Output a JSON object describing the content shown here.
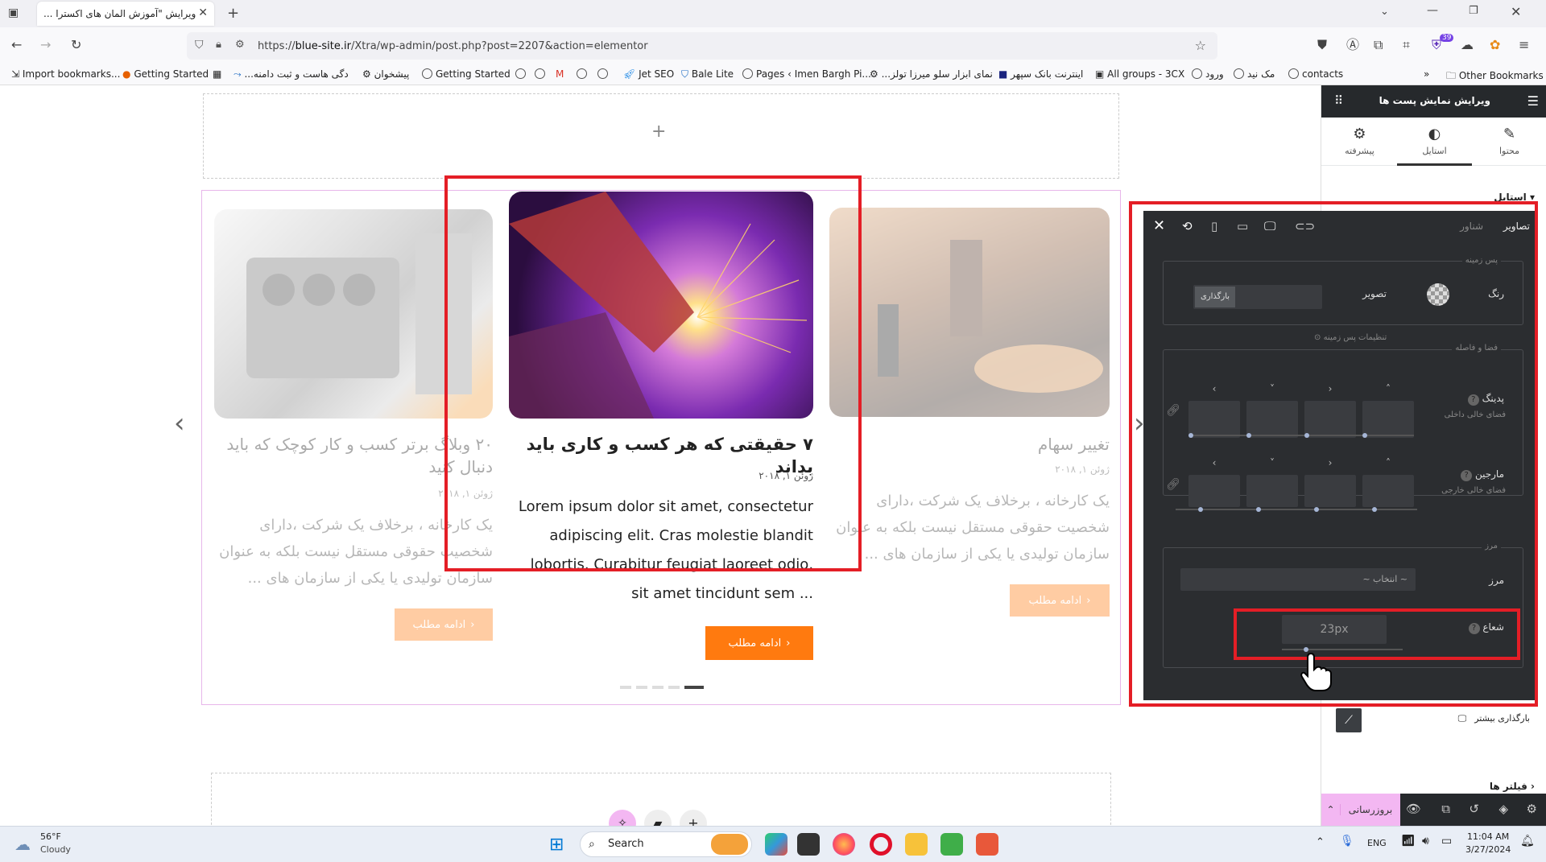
{
  "browser": {
    "tab_title": "ویرایش \"آموزش المان های اکسترا ...",
    "url_prefix": "https://",
    "url_domain": "blue-site.ir",
    "url_rest": "/Xtra/wp-admin/post.php?post=2207&action=elementor",
    "bookmarks": [
      "Import bookmarks...",
      "Getting Started",
      "...دگی هاست و ثبت دامنه",
      "پیشخوان",
      "Getting Started",
      "Jet SEO",
      "Bale Lite",
      "Pages ‹ Imen Bargh Pi...",
      "...نمای ابزار سلو میرزا تولز",
      "اینترنت بانک سپهر",
      "All groups - 3CX",
      "ورود",
      "مک نید",
      "contacts"
    ],
    "other_bookmarks": "Other Bookmarks",
    "extension_badge": "39"
  },
  "canvas": {
    "add_section": "+",
    "cards": [
      {
        "title": "۲۰ وبلاگ برتر کسب و کار کوچک که باید دنبال کنید",
        "date": "ژوئن ۱, ۲۰۱۸",
        "excerpt": "یک کارخانه ، برخلاف یک شرکت ،دارای شخصیت حقوقی مستقل نیست بلکه به عنوان سازمان تولیدی یا یکی از سازمان های ...",
        "button": "ادامه مطلب"
      },
      {
        "title": "۷ حقیقتی که هر کسب و کاری باید بداند",
        "date": "ژوئن ۱, ۲۰۱۸",
        "excerpt": "Lorem ipsum dolor sit amet, consectetur adipiscing elit. Cras molestie blandit lobortis. Curabitur feugiat laoreet odio, sit amet tincidunt sem ...",
        "button": "ادامه مطلب"
      },
      {
        "title": "تغییر سهام",
        "date": "ژوئن ۱, ۲۰۱۸",
        "excerpt": "یک کارخانه ، برخلاف یک شرکت ،دارای شخصیت حقوقی مستقل نیست بلکه به عنوان سازمان تولیدی یا یکی از سازمان های ...",
        "button": "ادامه مطلب"
      }
    ],
    "prev_arrow": "‹",
    "next_arrow": "›"
  },
  "panel": {
    "header_title": "ویرایش نمایش پست ها",
    "tabs": [
      "محتوا",
      "استایل",
      "پیشرفته"
    ],
    "style_section": "استایل",
    "load_more": "بارگذاری بیشتر",
    "filters": "فیلتر ها",
    "update_button": "بروزرسانی"
  },
  "popover": {
    "tab_images": "تصاویر",
    "tab_overlay": "شناور",
    "background_title": "پس زمینه",
    "color_label": "رنگ",
    "image_label": "تصویر",
    "upload_label": "بارگذاری",
    "bg_settings": "تنظیمات پس زمینه",
    "spacing_title": "فضا و فاصله",
    "padding_label": "پدینگ",
    "padding_hint": "فضای خالی داخلی",
    "margin_label": "مارجین",
    "margin_hint": "فضای خالی خارجی",
    "border_title": "مرز",
    "border_label": "مرز",
    "border_select": "~ انتخاب ~",
    "radius_label": "شعاع",
    "radius_value": "23px",
    "radius_level": 0.2
  },
  "taskbar": {
    "weather_temp": "56°F",
    "weather_text": "Cloudy",
    "search": "Search",
    "lang": "ENG",
    "time": "11:04 AM",
    "date": "3/27/2024"
  },
  "colors": {
    "accent_orange": "#ff7a0f",
    "highlight_red": "#e41e26",
    "panel_dark": "#26292c",
    "popover_bg": "#2b2d30"
  }
}
